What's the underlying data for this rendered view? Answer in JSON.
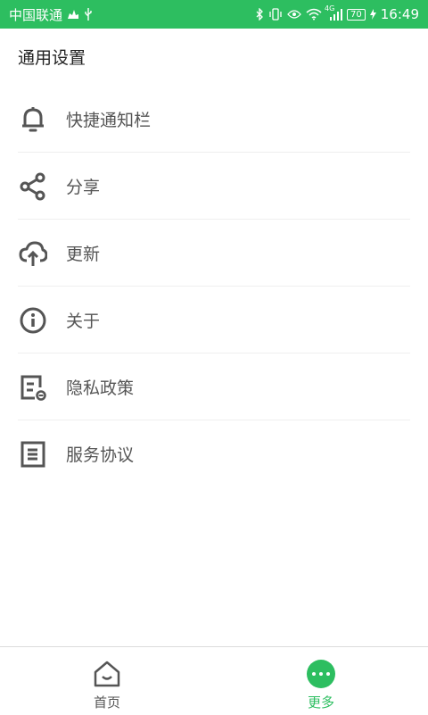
{
  "status_bar": {
    "carrier": "中国联通",
    "network": "4G",
    "battery": "70",
    "time": "16:49",
    "background_color": "#2dbe60"
  },
  "section_title": "通用设置",
  "menu": {
    "items": [
      {
        "label": "快捷通知栏",
        "icon": "bell-icon"
      },
      {
        "label": "分享",
        "icon": "share-icon"
      },
      {
        "label": "更新",
        "icon": "cloud-upload-icon"
      },
      {
        "label": "关于",
        "icon": "info-icon"
      },
      {
        "label": "隐私政策",
        "icon": "privacy-policy-icon"
      },
      {
        "label": "服务协议",
        "icon": "agreement-icon"
      }
    ]
  },
  "bottom_nav": {
    "tabs": [
      {
        "label": "首页",
        "icon": "home-icon",
        "active": false
      },
      {
        "label": "更多",
        "icon": "more-icon",
        "active": true
      }
    ],
    "active_color": "#2dbe60"
  }
}
